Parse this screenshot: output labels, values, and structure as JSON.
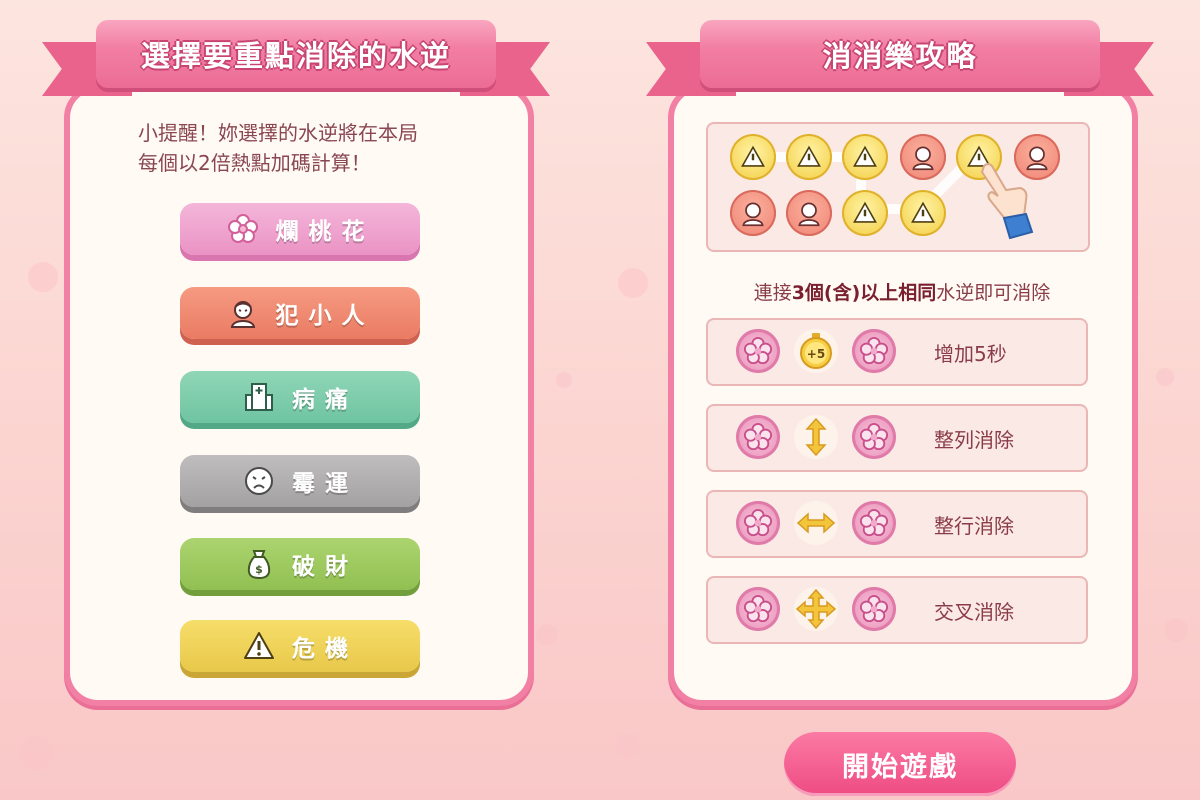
{
  "left_panel": {
    "title": "選擇要重點消除的水逆",
    "hint_line1": "小提醒！妳選擇的水逆將在本局",
    "hint_line2": "每個以2倍熱點加碼計算！",
    "buttons": [
      {
        "label": "爛桃花",
        "icon": "flower-icon",
        "color": "#ea93c4"
      },
      {
        "label": "犯小人",
        "icon": "person-icon",
        "color": "#ea7b63"
      },
      {
        "label": "病痛",
        "icon": "hospital-icon",
        "color": "#6fc4a1"
      },
      {
        "label": "霉運",
        "icon": "sad-face-icon",
        "color": "#a3a1a1"
      },
      {
        "label": "破財",
        "icon": "money-bag-icon",
        "color": "#91c052"
      },
      {
        "label": "危機",
        "icon": "warning-icon",
        "color": "#e8c84a"
      }
    ]
  },
  "right_panel": {
    "title": "消消樂攻略",
    "rule_prefix": "連接",
    "rule_bold": "3個(含)以上相同",
    "rule_suffix": "水逆即可消除",
    "combos": [
      {
        "effect": "增加5秒",
        "middle_icon": "stopwatch-plus5-icon",
        "badge": "+5"
      },
      {
        "effect": "整列消除",
        "middle_icon": "vertical-arrows-icon"
      },
      {
        "effect": "整行消除",
        "middle_icon": "horizontal-arrows-icon"
      },
      {
        "effect": "交叉消除",
        "middle_icon": "cross-arrows-icon"
      }
    ]
  },
  "start_button": "開始遊戲",
  "colors": {
    "accent_pink": "#f27fa4",
    "start_button": "#ee4b82",
    "panel_bg": "#fffaf3"
  }
}
